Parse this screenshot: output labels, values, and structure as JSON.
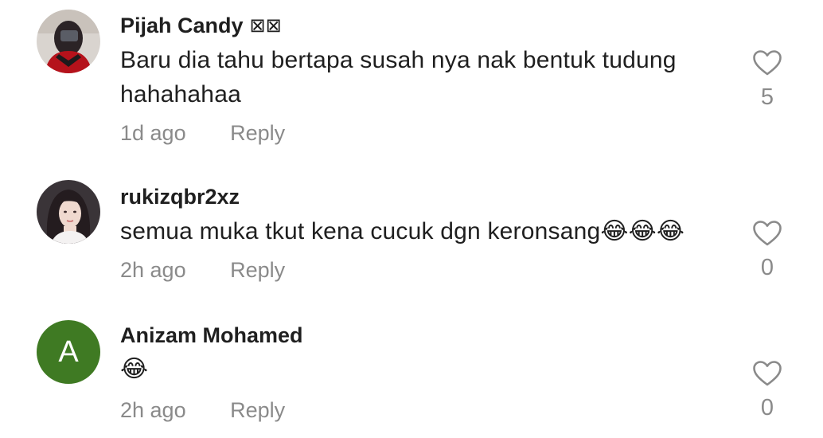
{
  "comments": [
    {
      "username": "Pijah Candy",
      "flag": "⊠⊠",
      "text": "Baru dia tahu bertapa susah nya nak bentuk tudung hahahahaa",
      "time": "1d ago",
      "reply_label": "Reply",
      "likes": "5",
      "avatar": "photo-avatar"
    },
    {
      "username": "rukizqbr2xz",
      "text": "semua muka tkut kena cucuk dgn keronsang😂😂😂",
      "time": "2h ago",
      "reply_label": "Reply",
      "likes": "0",
      "avatar": "photo-avatar"
    },
    {
      "username": "Anizam Mohamed",
      "text": "😂",
      "time": "2h ago",
      "reply_label": "Reply",
      "likes": "0",
      "avatar_letter": "A",
      "avatar_color": "#3f7a23"
    }
  ],
  "colors": {
    "text": "#1f1f1f",
    "muted": "#8a8a8a",
    "heart_stroke": "#8a8a8a"
  },
  "icons": {
    "like": "heart-outline-icon"
  }
}
